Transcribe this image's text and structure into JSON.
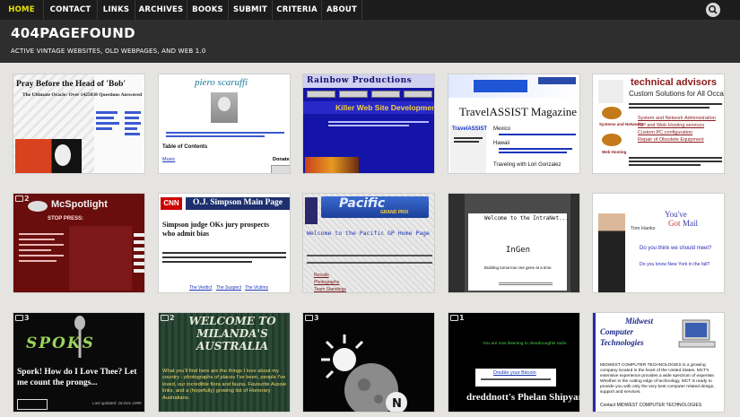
{
  "nav": {
    "items": [
      {
        "label": "HOME"
      },
      {
        "label": "CONTACT"
      },
      {
        "label": "LINKS"
      },
      {
        "label": "ARCHIVES"
      },
      {
        "label": "BOOKS"
      },
      {
        "label": "SUBMIT"
      },
      {
        "label": "CRITERIA"
      },
      {
        "label": "ABOUT"
      }
    ],
    "active_color": "#e8e100"
  },
  "site": {
    "title": "404PAGEFOUND",
    "tagline": "ACTIVE VINTAGE WEBSITES, OLD WEBPAGES, AND WEB 1.0"
  },
  "thumbs": {
    "t1": {
      "heading": "Pray Before the Head of 'Bob'",
      "sub": "The Ultimate Oracle: Over 1425038 Questions Answered"
    },
    "t2": {
      "heading": "piero scaruffi",
      "toc": "Table of Contents",
      "music": "Music",
      "donate": "Donate"
    },
    "t3": {
      "brand": "Rainbow Productions",
      "marquee": "Killer Web Site Development"
    },
    "t4": {
      "heading": "TravelASSIST Magazine",
      "subtitle": "TravelASSIST",
      "items": [
        "Mexico",
        "Hawaii",
        "Traveling with Lori Gonzalez"
      ]
    },
    "t5": {
      "heading": "technical advisors",
      "subtitle": "Custom Solutions for All Occasions",
      "links": [
        "System and Network Administration",
        "ISP and Web Hosting services",
        "Custom PC configuration",
        "Repair of Obsolete Equipment"
      ],
      "caption1": "Systems and Networks",
      "caption2": "Web Hosting"
    },
    "t6": {
      "comments": "2",
      "heading": "McSpotlight",
      "stop": "STOP PRESS:"
    },
    "t7": {
      "cnn": "CNN",
      "heading": "O.J. Simpson Main Page",
      "headline": "Simpson judge OKs jury prospects who admit bias",
      "footer": [
        "The Verdict",
        "The Suspect",
        "The Victims"
      ]
    },
    "t8": {
      "heading": "Pacific",
      "subheading": "GRAND PRIX",
      "welcome": "Welcome to the Pacific GP Home Page",
      "links": [
        "Results",
        "Photographs",
        "Team Standings"
      ]
    },
    "t9": {
      "welcome": "Welcome to the IntraNet...",
      "name": "InGen",
      "note": "Building tomorrow one gene at a time"
    },
    "t10": {
      "name": "Tom Hanks",
      "logo1": "You've",
      "logo2": "Got",
      "logo3": "Mail",
      "q1": "Do you think we should meet?",
      "q2": "Do you know New York in the fall?"
    },
    "t11": {
      "comments": "3",
      "logo": "SPOKS",
      "text": "Spork! How do I Love Thee? Let me count the prongs...",
      "updated": "Last updated: 18-Dec-1999"
    },
    "t12": {
      "comments": "2",
      "heading": "WELCOME TO MILANDA'S AUSTRALIA",
      "body": "What you'll find here are the things I love about my country - photographs of places I've been, people I've loved, our incredible flora and fauna. Favourite Aussie links, and a (hopefully) growing list of Honorary Australians."
    },
    "t13": {
      "comments": "3",
      "badge": "N"
    },
    "t14": {
      "comments": "1",
      "top": "You are now listening to dreadnoughts radio",
      "bitcoin": "Double your Bitcoin",
      "heading": "dreddnott's Phelan Shipyards"
    },
    "t15": {
      "heading1": "Midwest",
      "heading2": "Computer",
      "heading3": "Technologies",
      "body": "MIDWEST COMPUTER TECHNOLOGIES is a growing company located in the heart of the United States. MCT's extensive experience provides a wide spectrum of expertise. Whether in the cutting edge of technology, MCT is ready to provide you with only the very best computer related design, support and services.",
      "contact": "Contact MIDWEST COMPUTER TECHNOLOGIES"
    }
  },
  "colors": {
    "nav_bg": "#1c1c1c",
    "header_bg": "#2e2e2e",
    "page_bg": "#e6e4e0"
  }
}
